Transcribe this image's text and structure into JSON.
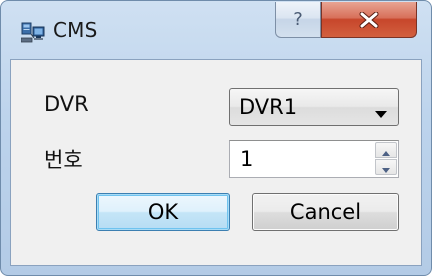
{
  "window": {
    "title": "CMS",
    "help_label": "?",
    "app_icon": "computer-network-icon",
    "close_icon": "close-icon"
  },
  "form": {
    "dvr_label": "DVR",
    "dvr_selected": "DVR1",
    "number_label": "번호",
    "number_value": "1"
  },
  "buttons": {
    "ok_label": "OK",
    "cancel_label": "Cancel"
  },
  "colors": {
    "frame_accent": "#bcd3ec",
    "close_button": "#c7462b",
    "default_button_border": "#3c7fb1",
    "client_background": "#f0f0f0"
  }
}
